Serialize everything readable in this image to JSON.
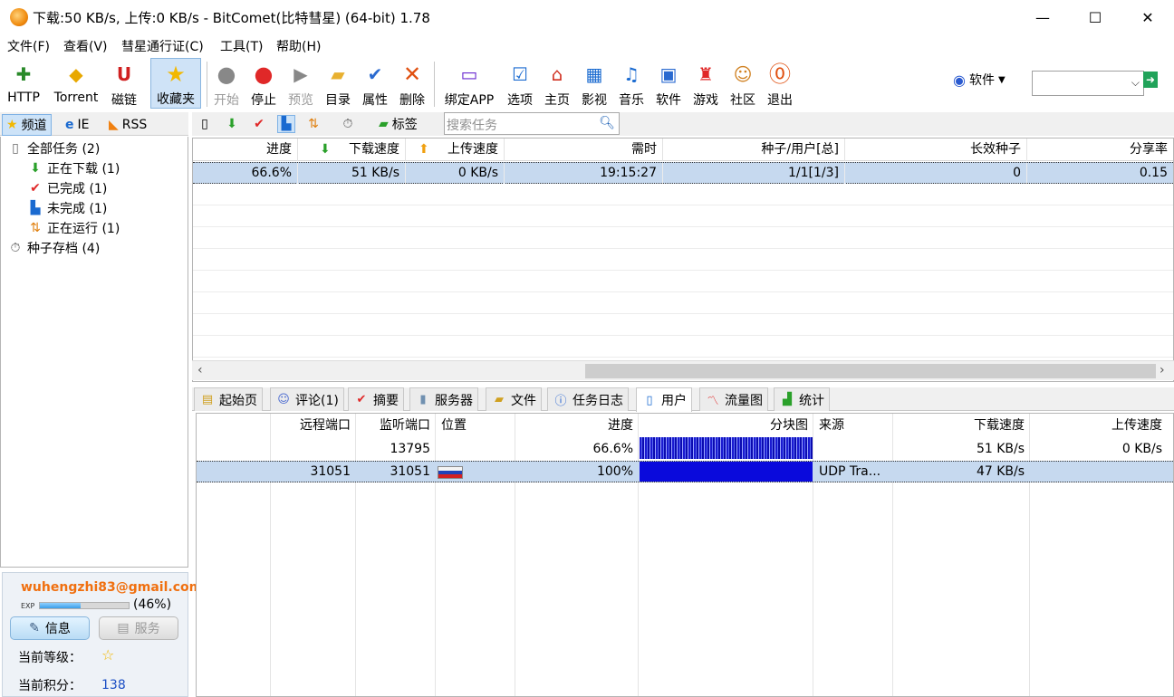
{
  "window": {
    "title": "下载:50 KB/s, 上传:0 KB/s - BitComet(比特彗星) (64-bit) 1.78",
    "minimize": "—",
    "maximize": "☐",
    "close": "✕"
  },
  "menu": [
    "文件(F)",
    "查看(V)",
    "彗星通行证(C)",
    "工具(T)",
    "帮助(H)"
  ],
  "toolbar": {
    "buttons": [
      {
        "label": "HTTP",
        "icon": "http-add-icon",
        "enabled": true
      },
      {
        "label": "Torrent",
        "icon": "torrent-add-icon",
        "enabled": true
      },
      {
        "label": "磁链",
        "icon": "magnet-icon",
        "enabled": true
      },
      {
        "label": "收藏夹",
        "icon": "star-icon",
        "enabled": true,
        "active": true
      },
      {
        "label": "开始",
        "icon": "play-icon",
        "enabled": false
      },
      {
        "label": "停止",
        "icon": "stop-icon",
        "enabled": true
      },
      {
        "label": "预览",
        "icon": "preview-icon",
        "enabled": false
      },
      {
        "label": "目录",
        "icon": "folder-icon",
        "enabled": true
      },
      {
        "label": "属性",
        "icon": "properties-icon",
        "enabled": true
      },
      {
        "label": "删除",
        "icon": "delete-icon",
        "enabled": true
      },
      {
        "label": "绑定APP",
        "icon": "bind-app-icon",
        "enabled": true
      },
      {
        "label": "选项",
        "icon": "options-icon",
        "enabled": true
      },
      {
        "label": "主页",
        "icon": "home-icon",
        "enabled": true
      },
      {
        "label": "影视",
        "icon": "video-icon",
        "enabled": true
      },
      {
        "label": "音乐",
        "icon": "music-icon",
        "enabled": true
      },
      {
        "label": "软件",
        "icon": "software-icon",
        "enabled": true
      },
      {
        "label": "游戏",
        "icon": "game-icon",
        "enabled": true
      },
      {
        "label": "社区",
        "icon": "community-icon",
        "enabled": true
      },
      {
        "label": "退出",
        "icon": "exit-icon",
        "enabled": true
      }
    ],
    "software_dropdown": "软件",
    "search_value": ""
  },
  "left": {
    "tabs": [
      "频道",
      "IE",
      "RSS"
    ],
    "tree": [
      {
        "label": "全部任务 (2)",
        "icon": "all-tasks-icon",
        "level": 0
      },
      {
        "label": "正在下载 (1)",
        "icon": "downloading-icon",
        "level": 1
      },
      {
        "label": "已完成 (1)",
        "icon": "completed-icon",
        "level": 1
      },
      {
        "label": "未完成 (1)",
        "icon": "incomplete-icon",
        "level": 1
      },
      {
        "label": "正在运行 (1)",
        "icon": "running-icon",
        "level": 1
      },
      {
        "label": "种子存档 (4)",
        "icon": "torrent-archive-icon",
        "level": 0
      }
    ],
    "user": {
      "email": "wuhengzhi83@gmail.com",
      "exp_label": "EXP",
      "exp_fraction": 0.46,
      "exp_percent": "(46%)",
      "info_button": "信息",
      "service_button": "服务",
      "level_label": "当前等级：",
      "points_label": "当前积分：",
      "points_value": "138"
    }
  },
  "task_toolbar": {
    "tag_label": "标签",
    "search_placeholder": "搜索任务"
  },
  "tasks": {
    "columns": [
      "进度",
      "下载速度",
      "上传速度",
      "需时",
      "种子/用户[总]",
      "长效种子",
      "分享率"
    ],
    "rows": [
      {
        "progress": "66.6%",
        "down": "51 KB/s",
        "up": "0 KB/s",
        "eta": "19:15:27",
        "seeds": "1/1[1/3]",
        "long_seeds": "0",
        "ratio": "0.15"
      }
    ]
  },
  "detail_tabs": [
    "起始页",
    "评论(1)",
    "摘要",
    "服务器",
    "文件",
    "任务日志",
    "用户",
    "流量图",
    "统计"
  ],
  "peers": {
    "columns": [
      "远程端口",
      "监听端口",
      "位置",
      "进度",
      "分块图",
      "来源",
      "下载速度",
      "上传速度"
    ],
    "rows": [
      {
        "remote_port": "",
        "listen_port": "13795",
        "location": "",
        "progress": "66.6%",
        "pieces": "partial",
        "source": "",
        "down": "51 KB/s",
        "up": "0 KB/s"
      },
      {
        "remote_port": "31051",
        "listen_port": "31051",
        "location": "flag-ru",
        "progress": "100%",
        "pieces": "full",
        "source": "UDP Tra...",
        "down": "47 KB/s",
        "up": ""
      }
    ]
  }
}
